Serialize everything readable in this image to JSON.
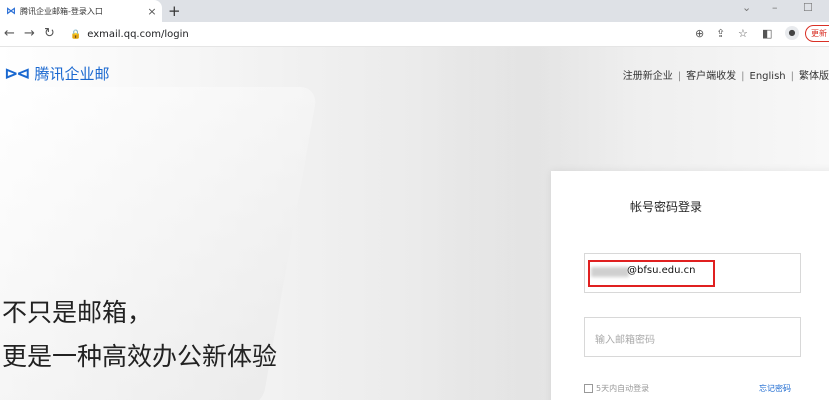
{
  "browser": {
    "tab_title": "腾讯企业邮箱-登录入口",
    "tab_icon": "tencent-mail-icon",
    "new_tab": "+",
    "close_tab": "×",
    "url": "exmail.qq.com/login",
    "update_label": "更新",
    "window": {
      "minimize": "–",
      "restore": "☐",
      "chevron": "⌄"
    }
  },
  "header": {
    "logo_text": "腾讯企业邮",
    "links": [
      "注册新企业",
      "客户端收发",
      "English",
      "繁体版"
    ]
  },
  "hero": {
    "line1": "不只是邮箱，",
    "line2": "更是一种高效办公新体验"
  },
  "login": {
    "title": "帐号密码登录",
    "account_value": "@bfsu.edu.cn",
    "password_placeholder": "输入邮箱密码",
    "remember_label": "5天内自动登录",
    "forgot_label": "忘记密码"
  },
  "colors": {
    "brand": "#1a68d0",
    "highlight": "#e02020"
  }
}
